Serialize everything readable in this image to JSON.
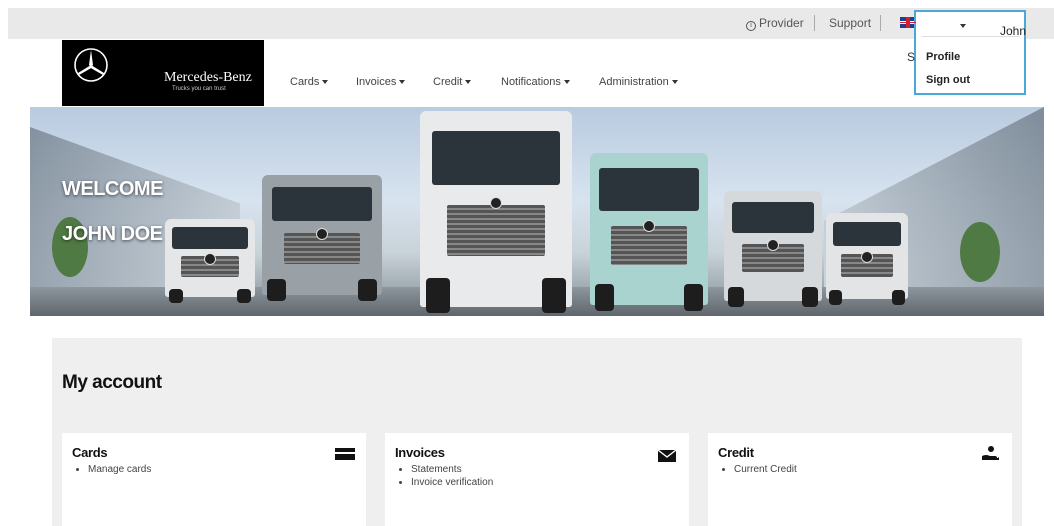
{
  "topbar": {
    "provider_label": "Provider",
    "support_label": "Support",
    "language_icon": "uk-flag-icon",
    "user_name": "John Doe"
  },
  "user_menu": {
    "items": [
      {
        "label": "Profile"
      },
      {
        "label": "Sign out"
      }
    ]
  },
  "brand": {
    "name": "Mercedes-Benz",
    "tagline": "Trucks you can trust",
    "logo_icon": "mercedes-star-icon"
  },
  "nav": {
    "items": [
      {
        "label": "Cards"
      },
      {
        "label": "Invoices"
      },
      {
        "label": "Credit"
      },
      {
        "label": "Notifications"
      },
      {
        "label": "Administration"
      }
    ],
    "search_letter": "S"
  },
  "hero": {
    "welcome_line1": "WELCOME",
    "welcome_line2": "JOHN DOE"
  },
  "account": {
    "title": "My account",
    "cards": [
      {
        "title": "Cards",
        "icon": "card-icon",
        "links": [
          "Manage cards"
        ]
      },
      {
        "title": "Invoices",
        "icon": "envelope-icon",
        "links": [
          "Statements",
          "Invoice verification"
        ]
      },
      {
        "title": "Credit",
        "icon": "hand-coins-icon",
        "links": [
          "Current Credit"
        ]
      }
    ]
  },
  "colors": {
    "highlight": "#4aa8d8",
    "topbar_bg": "#e9e9e9",
    "account_bg": "#efefef",
    "logo_bg": "#000000"
  }
}
